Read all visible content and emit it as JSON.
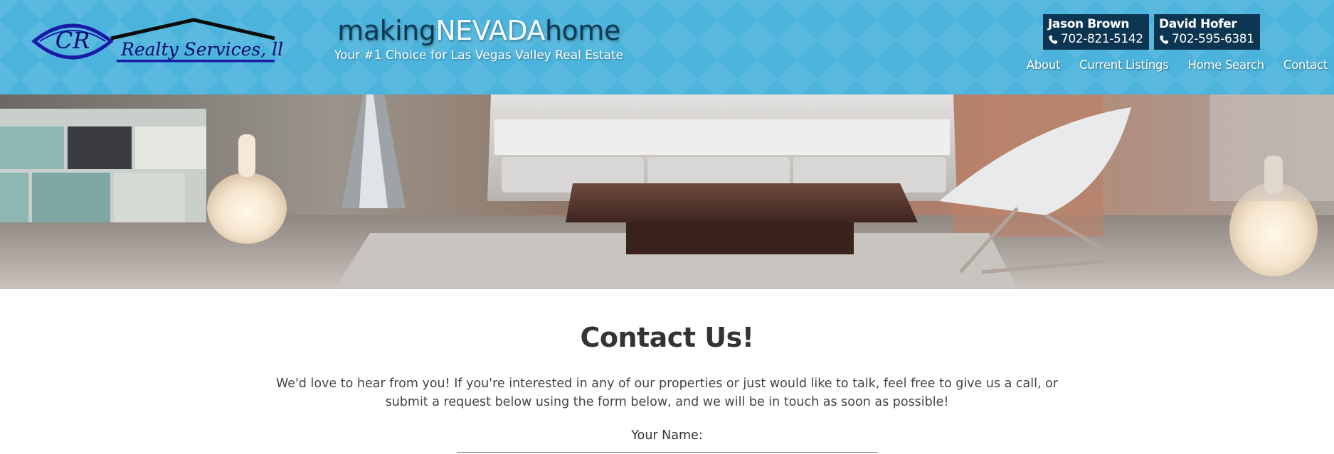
{
  "brand": {
    "logo_initials": "CR",
    "logo_text": "Realty Services, llc",
    "tagline_parts": [
      "making",
      "NEVADA",
      "home"
    ],
    "subtitle": "Your #1 Choice for Las Vegas Valley Real Estate"
  },
  "agents": [
    {
      "name": "Jason Brown",
      "phone": "702-821-5142",
      "icon": "phone-icon"
    },
    {
      "name": "David Hofer",
      "phone": "702-595-6381",
      "icon": "phone-icon"
    }
  ],
  "nav": {
    "items": [
      "About",
      "Current Listings",
      "Home Search",
      "Contact"
    ]
  },
  "content": {
    "title": "Contact Us!",
    "intro": "We'd love to hear from you! If you're interested in any of our properties or just would like to talk, feel free to give us a call, or submit a request below using the form below, and we will be in touch as soon as possible!",
    "form": {
      "name_label": "Your Name:",
      "name_value": ""
    }
  },
  "colors": {
    "header_bg": "#4cb4dc",
    "agent_box": "#0c3552",
    "tagline_dark": "#0d3b55",
    "logo_blue": "#1a1aa8"
  }
}
